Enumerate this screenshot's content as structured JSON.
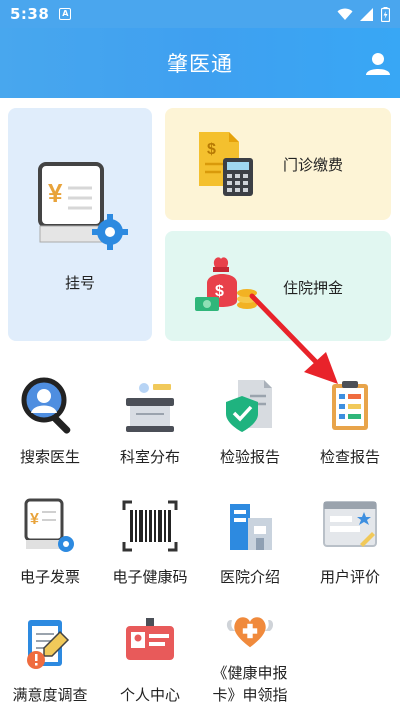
{
  "status_bar": {
    "time": "5:38",
    "notification_icon": "A"
  },
  "header": {
    "title": "肇医通",
    "user_icon": "user-icon"
  },
  "cards": {
    "register": {
      "label": "挂号"
    },
    "outpatient_payment": {
      "label": "门诊缴费"
    },
    "inpatient_deposit": {
      "label": "住院押金"
    }
  },
  "grid": [
    {
      "label": "搜索医生",
      "icon": "search-doctor-icon"
    },
    {
      "label": "科室分布",
      "icon": "department-icon"
    },
    {
      "label": "检验报告",
      "icon": "lab-report-icon"
    },
    {
      "label": "检查报告",
      "icon": "exam-report-icon"
    },
    {
      "label": "电子发票",
      "icon": "e-invoice-icon"
    },
    {
      "label": "电子健康码",
      "icon": "barcode-icon"
    },
    {
      "label": "医院介绍",
      "icon": "hospital-icon"
    },
    {
      "label": "用户评价",
      "icon": "review-icon"
    },
    {
      "label": "满意度调查",
      "icon": "survey-icon"
    },
    {
      "label": "个人中心",
      "icon": "id-card-icon"
    },
    {
      "label": "《健康申报卡》申领指",
      "icon": "health-heart-icon"
    }
  ],
  "colors": {
    "header": "#48a7ee",
    "arrow": "#e8232a"
  }
}
